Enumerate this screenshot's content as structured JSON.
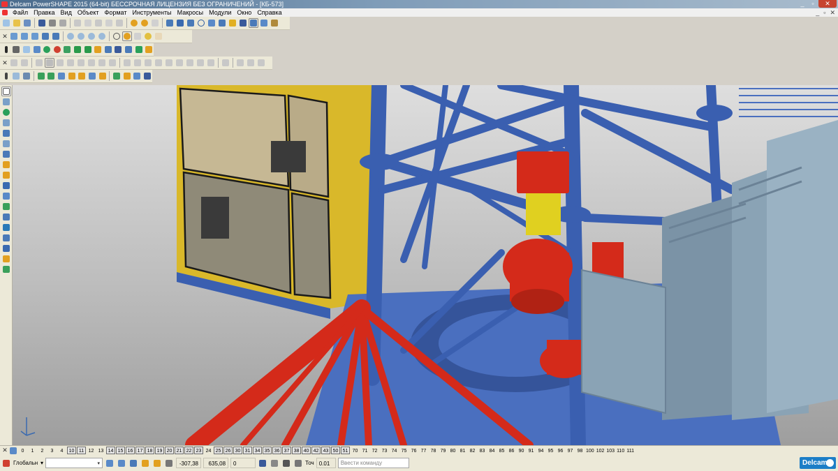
{
  "window": {
    "title": "Delcam PowerSHAPE 2015 (64-bit) БЕССРОЧНАЯ ЛИЦЕНЗИЯ БЕЗ ОГРАНИЧЕНИЙ - [КБ-573]",
    "min": "_",
    "restore": "▫",
    "close": "✕"
  },
  "menu": {
    "items": [
      "Файл",
      "Правка",
      "Вид",
      "Объект",
      "Формат",
      "Инструменты",
      "Макросы",
      "Модули",
      "Окно",
      "Справка"
    ],
    "right": [
      "_",
      "▫",
      "✕"
    ]
  },
  "levels": {
    "items": [
      "0",
      "1",
      "2",
      "3",
      "4",
      "10",
      "11",
      "12",
      "13",
      "14",
      "15",
      "16",
      "17",
      "18",
      "19",
      "20",
      "21",
      "22",
      "23",
      "24",
      "25",
      "26",
      "30",
      "31",
      "34",
      "35",
      "36",
      "37",
      "38",
      "40",
      "42",
      "43",
      "50",
      "51",
      "70",
      "71",
      "72",
      "73",
      "74",
      "75",
      "76",
      "77",
      "78",
      "79",
      "80",
      "81",
      "82",
      "83",
      "84",
      "85",
      "86",
      "90",
      "91",
      "94",
      "95",
      "96",
      "97",
      "98",
      "100",
      "102",
      "103",
      "110",
      "111"
    ],
    "active": [
      "10",
      "11",
      "14",
      "15",
      "16",
      "17",
      "18",
      "19",
      "20",
      "21",
      "22",
      "23",
      "25",
      "26",
      "30",
      "31",
      "34",
      "35",
      "36",
      "37",
      "38",
      "40",
      "42",
      "43",
      "50",
      "51"
    ]
  },
  "status": {
    "workplane": "Глобальн",
    "workplane_arrow": "▾",
    "coord_x": "-307,38",
    "coord_y": "635,08",
    "coord_z": "0",
    "tolerance_label": "Точ",
    "tolerance_value": "0.01",
    "command_placeholder": "Ввести команду"
  },
  "brand": {
    "logo_text": "Delcam"
  },
  "colors": {
    "structure_blue": "#3a5fb0",
    "part_red": "#d42a1a",
    "cabin_yellow": "#d9b82a",
    "panel_grey": "#8aa3b5"
  }
}
